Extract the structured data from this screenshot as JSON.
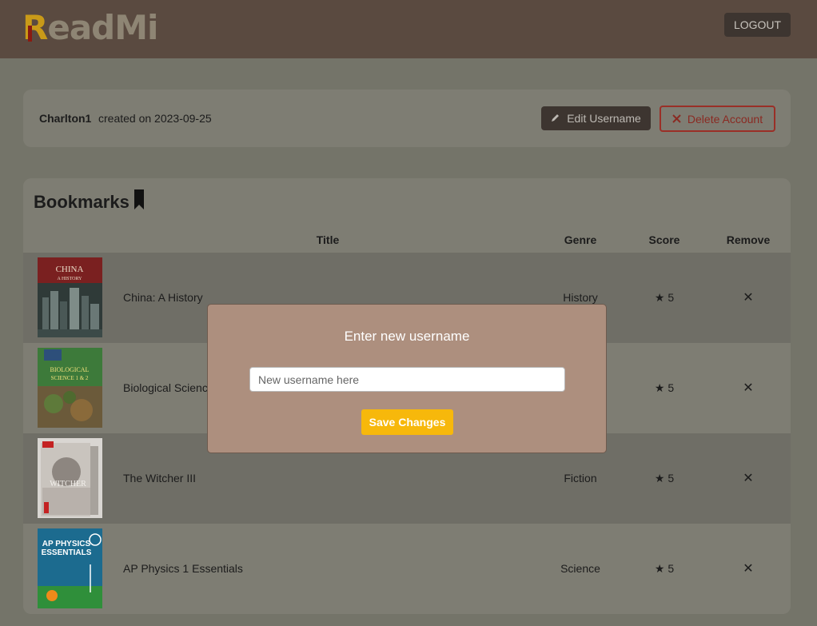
{
  "header": {
    "logo_first": "R",
    "logo_rest": "eadMi",
    "logout_label": "LOGOUT"
  },
  "user": {
    "username": "Charlton1",
    "created": "created on 2023-09-25",
    "edit_label": "Edit Username",
    "delete_label": "Delete Account"
  },
  "bookmarks": {
    "title": "Bookmarks",
    "columns": {
      "title": "Title",
      "genre": "Genre",
      "score": "Score",
      "remove": "Remove"
    },
    "rows": [
      {
        "title": "China: A History",
        "genre": "History",
        "score": "★ 5",
        "remove": "✕",
        "cover": {
          "line1": "CHINA",
          "line2": "A HISTORY"
        }
      },
      {
        "title": "Biological Science",
        "genre": "",
        "score": "★ 5",
        "remove": "✕",
        "cover": {
          "line1": "BIOLOGICAL",
          "line2": "SCIENCE 1 & 2"
        }
      },
      {
        "title": "The Witcher III",
        "genre": "Fiction",
        "score": "★ 5",
        "remove": "✕",
        "cover": {
          "line1": "WITCHER"
        }
      },
      {
        "title": "AP Physics 1 Essentials",
        "genre": "Science",
        "score": "★ 5",
        "remove": "✕",
        "cover": {
          "line1": "AP PHYSICS",
          "line2": "ESSENTIALS"
        }
      }
    ]
  },
  "modal": {
    "title": "Enter new username",
    "input_placeholder": "New username here",
    "save_label": "Save Changes"
  },
  "colors": {
    "header_bg": "#5a4a40",
    "page_bg": "#747469",
    "card_bg": "#7e7d73",
    "modal_bg": "#ad8f7e",
    "save_button": "#f7b80b",
    "delete_accent": "#9a2f27"
  }
}
